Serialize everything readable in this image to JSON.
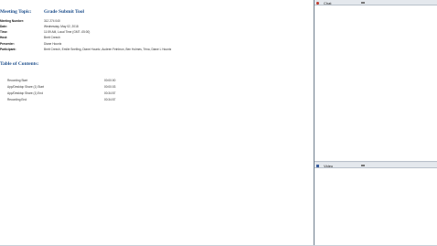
{
  "meeting": {
    "topic_label": "Meeting Topic:",
    "topic_value": "Grade Submit Tool"
  },
  "info": [
    {
      "label": "Meeting Number:",
      "value": "312 274 040"
    },
    {
      "label": "Date:",
      "value": "Wednesday, May 02, 2018"
    },
    {
      "label": "Time:",
      "value": "11:59 AM, Local Time (GMT -05:00)"
    },
    {
      "label": "Host:",
      "value": "Brett Creech"
    },
    {
      "label": "Presenter:",
      "value": "Diane Hountz"
    },
    {
      "label": "Participant:",
      "value": "Brett Creech,  Emilie Snelling,  Diane Hountz,  Audeen Feinbrun,  Ben Holmes,  Trina,  Diane L Hountz"
    }
  ],
  "toc": {
    "title": "Table of Contents:",
    "items": [
      {
        "name": "Recording Start",
        "time": "00:00:00"
      },
      {
        "name": "App/Desktop Share (1) Start",
        "time": "00:00:03"
      },
      {
        "name": "App/Desktop Share (1) End",
        "time": "00:34:57"
      },
      {
        "name": "Recording End",
        "time": "00:34:57"
      }
    ]
  },
  "side": {
    "chat_title": "Chat",
    "video_title": "Video"
  },
  "colors": {
    "heading_blue": "#1e4f8c",
    "chat_dot": "#c0392b",
    "video_icon": "#3b5f9e"
  }
}
